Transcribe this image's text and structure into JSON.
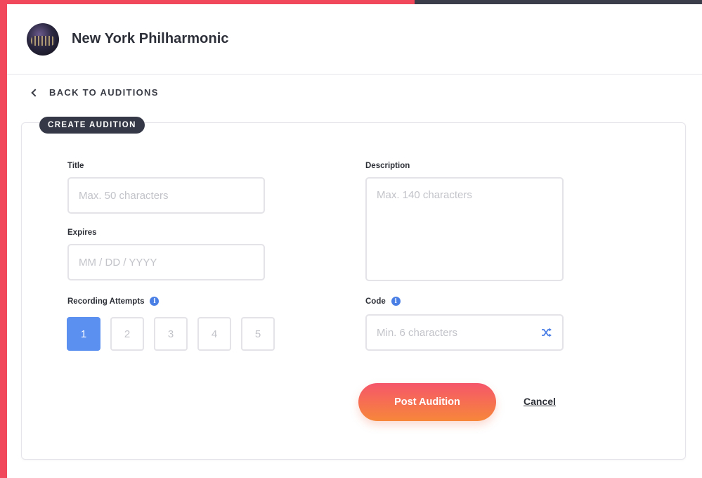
{
  "header": {
    "org_name": "New York Philharmonic"
  },
  "nav": {
    "back_label": "BACK TO AUDITIONS"
  },
  "card": {
    "tag": "CREATE AUDITION"
  },
  "form": {
    "title": {
      "label": "Title",
      "placeholder": "Max. 50 characters"
    },
    "expires": {
      "label": "Expires",
      "placeholder": "MM / DD / YYYY"
    },
    "description": {
      "label": "Description",
      "placeholder": "Max. 140 characters"
    },
    "attempts": {
      "label": "Recording Attempts",
      "options": [
        "1",
        "2",
        "3",
        "4",
        "5"
      ],
      "selected": "1"
    },
    "code": {
      "label": "Code",
      "placeholder": "Min. 6 characters"
    }
  },
  "actions": {
    "post_label": "Post Audition",
    "cancel_label": "Cancel"
  },
  "icons": {
    "back": "chevron-left-icon",
    "info": "info-icon",
    "shuffle": "shuffle-icon"
  },
  "colors": {
    "accent_red": "#f1485c",
    "accent_blue": "#5b8ff0",
    "button_gradient_end": "#f7873a"
  }
}
